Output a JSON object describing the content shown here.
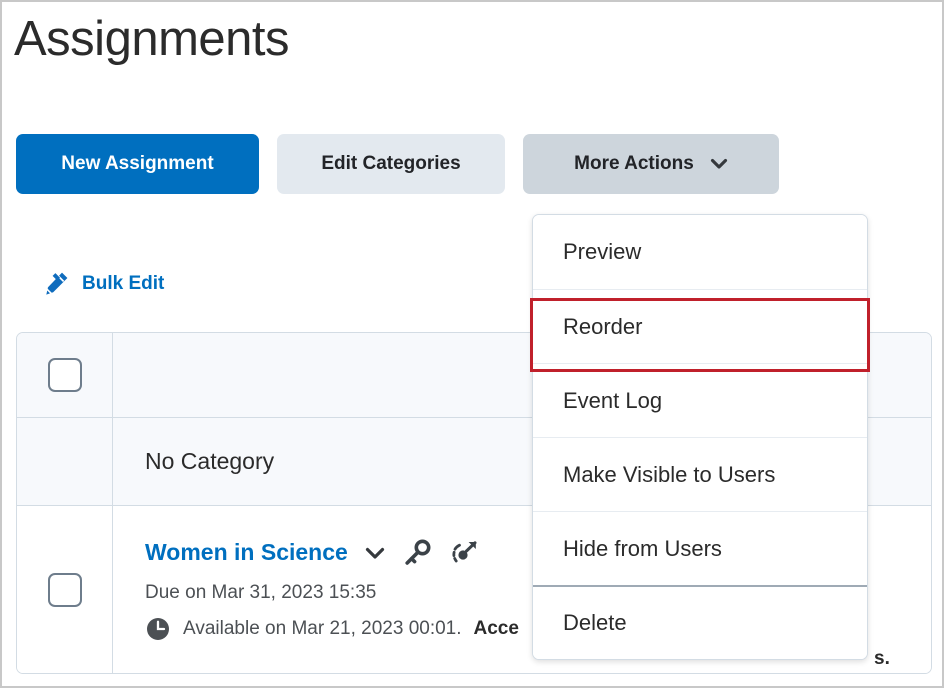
{
  "page": {
    "title": "Assignments"
  },
  "toolbar": {
    "new_assignment_label": "New Assignment",
    "edit_categories_label": "Edit Categories",
    "more_actions_label": "More Actions",
    "chevron_icon": "chevron-down-icon",
    "colors": {
      "primary": "#006FBF",
      "secondary": "#E3E9EF",
      "more_actions": "#CDD5DC"
    }
  },
  "bulk_edit": {
    "label": "Bulk Edit",
    "icon": "pencil-edit-icon"
  },
  "table": {
    "rows": [
      {
        "type": "header",
        "checkbox": "select-all-checkbox",
        "text": ""
      },
      {
        "type": "category",
        "text": "No Category"
      },
      {
        "type": "assignment",
        "name": "Women in Science",
        "caret_icon": "chevron-down-icon",
        "key_icon": "key-icon",
        "special_access_icon": "special-access-icon",
        "due": "Due on Mar 31, 2023 15:35",
        "clock_icon": "clock-icon",
        "available_prefix": "Available on Mar 21, 2023 00:01.",
        "available_bold": "Acce",
        "available_tail": "s."
      }
    ]
  },
  "menu": {
    "items": [
      {
        "label": "Preview",
        "highlighted": false
      },
      {
        "label": "Reorder",
        "highlighted": true
      },
      {
        "label": "Event Log",
        "highlighted": false
      },
      {
        "label": "Make Visible to Users",
        "highlighted": false
      },
      {
        "label": "Hide from Users",
        "highlighted": false
      },
      {
        "label": "Delete",
        "highlighted": false
      }
    ],
    "highlight_color": "#C0202B"
  }
}
